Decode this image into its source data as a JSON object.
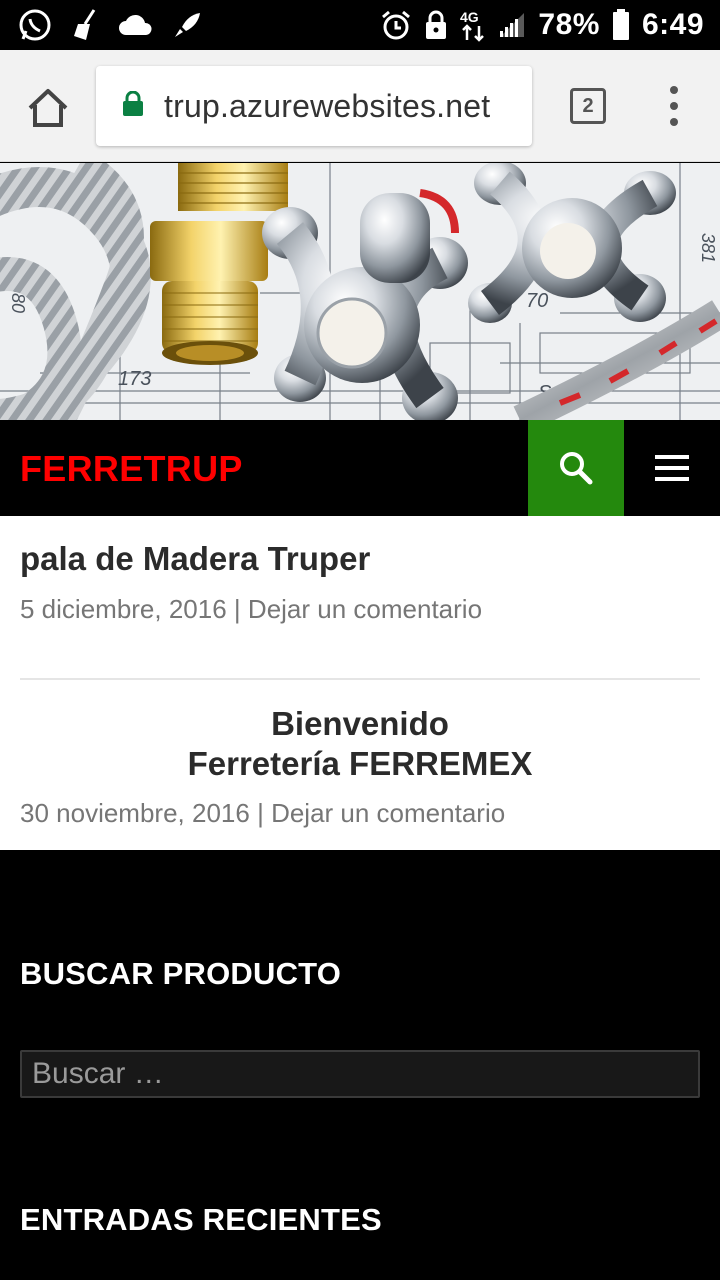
{
  "status_bar": {
    "battery_percent": "78%",
    "time": "6:49",
    "network": "4G",
    "left_icons": [
      "whatsapp-icon",
      "broom-icon",
      "cloud-icon",
      "rocket-icon"
    ],
    "right_icons": [
      "alarm-icon",
      "lock-icon",
      "network-4g-icon",
      "signal-icon",
      "battery-icon"
    ]
  },
  "browser": {
    "url": "trup.azurewebsites.net",
    "tab_count": "2",
    "secure_color": "#0b8043"
  },
  "site": {
    "title": "FERRETRUP",
    "title_color": "#ff0000",
    "search_button_color": "#24890d"
  },
  "posts": [
    {
      "title": "pala de Madera Truper",
      "date": "5 diciembre, 2016",
      "separator": "|",
      "comment_link": "Dejar un comentario"
    },
    {
      "title_line1": "Bienvenido",
      "title_line2": "Ferretería FERREMEX",
      "date": "30 noviembre, 2016",
      "separator": "|",
      "comment_link": "Dejar un comentario"
    }
  ],
  "widgets": {
    "search_title": "BUSCAR PRODUCTO",
    "search_placeholder": "Buscar …",
    "recent_title": "ENTRADAS RECIENTES"
  }
}
